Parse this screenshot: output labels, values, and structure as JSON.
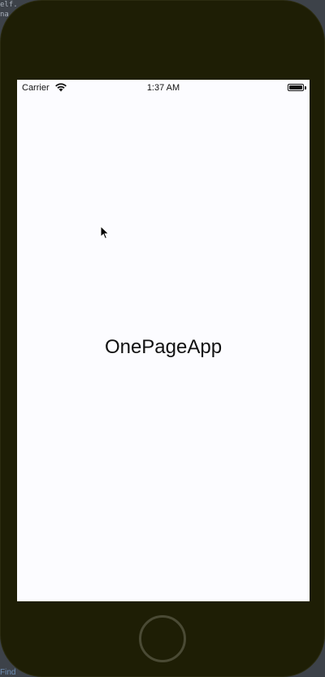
{
  "background": {
    "code_snippet": "elf.\nna",
    "bottom_text": "Find"
  },
  "status_bar": {
    "carrier": "Carrier",
    "time": "1:37 AM",
    "wifi_icon": "wifi-icon",
    "battery_icon": "battery-icon"
  },
  "app": {
    "title": "OnePageApp"
  },
  "device": {
    "home_button_icon": "home-button",
    "frame_color": "#1e1e05",
    "screen_color": "#fcfcff"
  }
}
